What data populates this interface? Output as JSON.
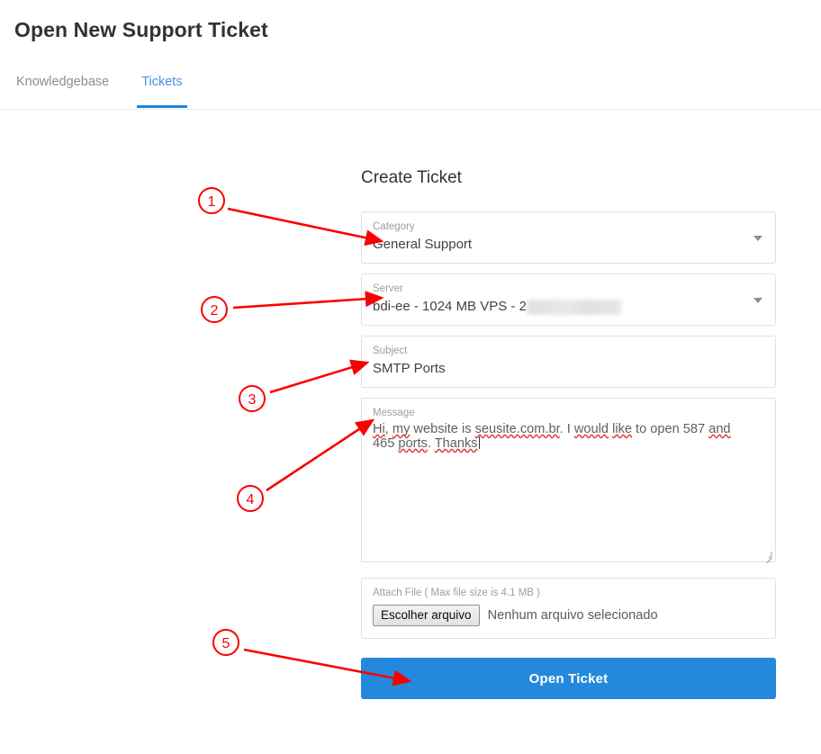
{
  "header": {
    "title": "Open New Support Ticket"
  },
  "tabs": [
    {
      "label": "Knowledgebase",
      "active": false
    },
    {
      "label": "Tickets",
      "active": true
    }
  ],
  "form": {
    "heading": "Create Ticket",
    "category": {
      "label": "Category",
      "value": "General Support",
      "caret": "chevron-down-icon"
    },
    "server": {
      "label": "Server",
      "value": "bdi-ee - 1024 MB VPS - 2",
      "redacted": true,
      "caret": "chevron-down-icon"
    },
    "subject": {
      "label": "Subject",
      "value": "SMTP Ports"
    },
    "message": {
      "label": "Message",
      "segments": [
        {
          "text": "Hi",
          "spellcheck": true
        },
        {
          "text": ", ",
          "spellcheck": false
        },
        {
          "text": "my",
          "spellcheck": true
        },
        {
          "text": " website is ",
          "spellcheck": false
        },
        {
          "text": "seusite.com.br",
          "spellcheck": true
        },
        {
          "text": ". I ",
          "spellcheck": false
        },
        {
          "text": "would",
          "spellcheck": true
        },
        {
          "text": " ",
          "spellcheck": false
        },
        {
          "text": "like",
          "spellcheck": true
        },
        {
          "text": " to open 587 ",
          "spellcheck": false
        },
        {
          "text": "and",
          "spellcheck": true
        },
        {
          "text": " 465 ",
          "spellcheck": false
        },
        {
          "text": "ports",
          "spellcheck": true
        },
        {
          "text": ". ",
          "spellcheck": false
        },
        {
          "text": "Thanks",
          "spellcheck": true
        }
      ],
      "plain_text": "Hi, my website is seusite.com.br. I would like to open 587 and 465 ports. Thanks",
      "cursor_visible": true
    },
    "attach": {
      "label": "Attach File ( Max file size is 4.1 MB )",
      "button_label": "Escolher arquivo",
      "status": "Nenhum arquivo selecionado"
    },
    "submit_label": "Open Ticket"
  },
  "annotations": [
    {
      "number": "1",
      "target": "category-field"
    },
    {
      "number": "2",
      "target": "server-field"
    },
    {
      "number": "3",
      "target": "subject-field"
    },
    {
      "number": "4",
      "target": "message-field"
    },
    {
      "number": "5",
      "target": "open-ticket-button"
    }
  ],
  "colors": {
    "accent_blue": "#2489dc",
    "tab_active": "#4a90e2",
    "annotation_red": "#fb0000",
    "text_dark": "#2e3338",
    "label_gray": "#9e9e9e"
  }
}
